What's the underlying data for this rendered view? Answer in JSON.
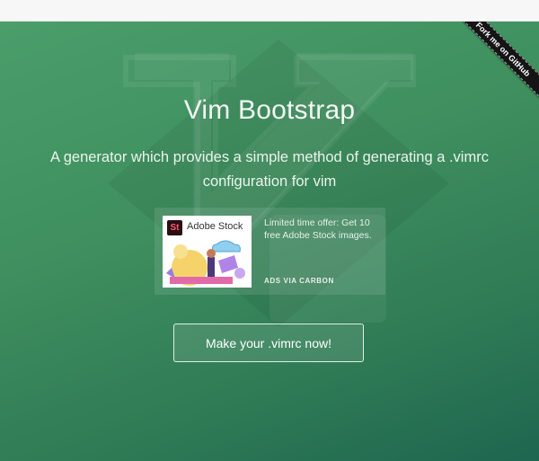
{
  "ribbon": {
    "label": "Fork me on GitHub"
  },
  "hero": {
    "title": "Vim Bootstrap",
    "subtitle": "A generator which provides a simple method of generating a .vimrc configuration for vim"
  },
  "ad": {
    "brand": "Adobe Stock",
    "logo_text": "St",
    "text": "Limited time offer: Get 10 free Adobe Stock images.",
    "via": "ADS VIA CARBON"
  },
  "cta": {
    "label": "Make your .vimrc now!"
  },
  "colors": {
    "hero_start": "#4a9e6a",
    "hero_end": "#1e6650",
    "ribbon": "#151515",
    "adobe_stock": "#2b0d12"
  }
}
